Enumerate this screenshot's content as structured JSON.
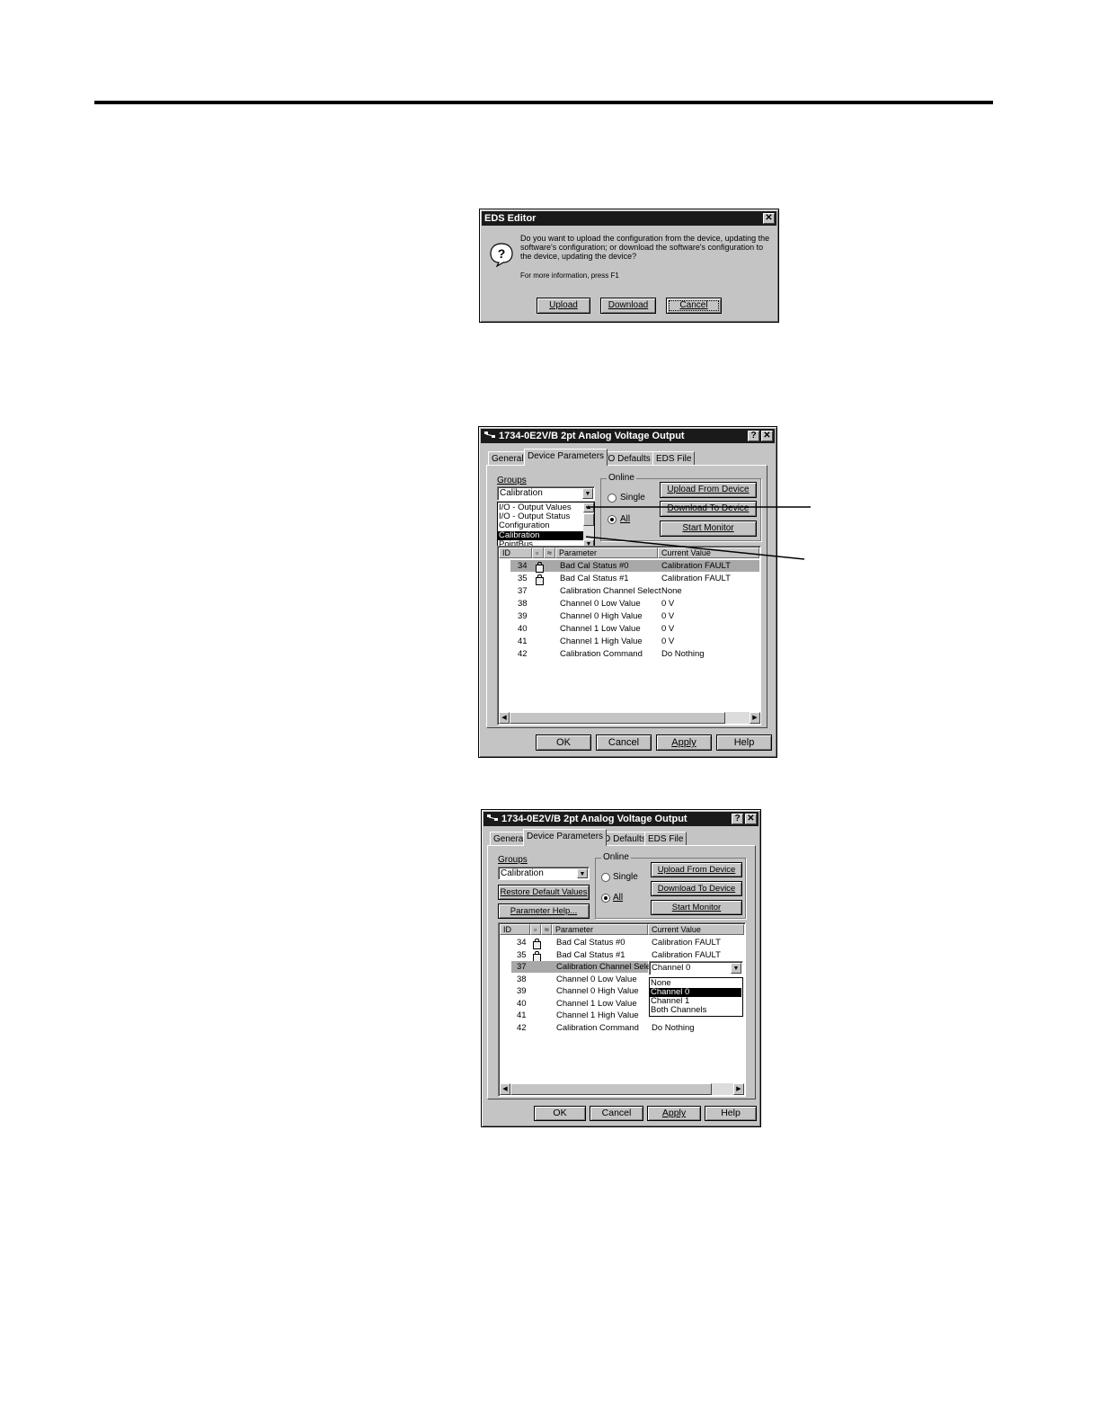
{
  "dialog_upload": {
    "title": "EDS Editor",
    "close": "✕",
    "message_lines": [
      "Do you want to upload the configuration from the device, updating the",
      "software's configuration; or download the software's configuration to",
      "the device, updating the device?"
    ],
    "help_text": "For more information, press F1",
    "icon": "question-icon",
    "buttons": {
      "upload": "Upload",
      "download": "Download",
      "cancel": "Cancel"
    }
  },
  "dialog_a": {
    "title": "1734-0E2V/B 2pt Analog Voltage Output",
    "help_btn": "?",
    "close_btn": "✕",
    "tabs": [
      "General",
      "Device Parameters",
      "I/O Defaults",
      "EDS File"
    ],
    "groups_label": "Groups",
    "groups_value": "Calibration",
    "groups_options": [
      "I/O - Output Values",
      "I/O - Output Status",
      "Configuration",
      "Calibration",
      "PointBus"
    ],
    "online_label": "Online",
    "radio_single": "Single",
    "radio_all": "All",
    "btn_upload": "Upload From Device",
    "btn_download": "Download To Device",
    "btn_monitor": "Start Monitor",
    "columns": [
      "ID",
      "Parameter",
      "Current Value"
    ],
    "rows": [
      {
        "id": "34",
        "param": "Bad Cal Status #0",
        "value": "Calibration FAULT"
      },
      {
        "id": "35",
        "param": "Bad Cal Status #1",
        "value": "Calibration FAULT"
      },
      {
        "id": "37",
        "param": "Calibration Channel Select",
        "value": "None"
      },
      {
        "id": "38",
        "param": "Channel 0 Low Value",
        "value": "0 V"
      },
      {
        "id": "39",
        "param": "Channel 0 High Value",
        "value": "0 V"
      },
      {
        "id": "40",
        "param": "Channel 1 Low Value",
        "value": "0 V"
      },
      {
        "id": "41",
        "param": "Channel 1 High Value",
        "value": "0 V"
      },
      {
        "id": "42",
        "param": "Calibration Command",
        "value": "Do Nothing"
      }
    ],
    "footer": {
      "ok": "OK",
      "cancel": "Cancel",
      "apply": "Apply",
      "help": "Help"
    }
  },
  "dialog_b": {
    "title": "1734-0E2V/B 2pt Analog Voltage Output",
    "help_btn": "?",
    "close_btn": "✕",
    "tabs": [
      "General",
      "Device Parameters",
      "I/O Defaults",
      "EDS File"
    ],
    "groups_label": "Groups",
    "groups_value": "Calibration",
    "btn_restore": "Restore Default Values",
    "btn_param_help": "Parameter Help...",
    "online_label": "Online",
    "radio_single": "Single",
    "radio_all": "All",
    "btn_upload": "Upload From Device",
    "btn_download": "Download To Device",
    "btn_monitor": "Start Monitor",
    "columns": [
      "ID",
      "Parameter",
      "Current Value"
    ],
    "rows": [
      {
        "id": "34",
        "param": "Bad Cal Status #0",
        "value": "Calibration FAULT"
      },
      {
        "id": "35",
        "param": "Bad Cal Status #1",
        "value": "Calibration FAULT"
      },
      {
        "id": "37",
        "param": "Calibration Channel Select",
        "value": ""
      },
      {
        "id": "38",
        "param": "Channel 0 Low Value",
        "value": ""
      },
      {
        "id": "39",
        "param": "Channel 0 High Value",
        "value": ""
      },
      {
        "id": "40",
        "param": "Channel 1 Low Value",
        "value": ""
      },
      {
        "id": "41",
        "param": "Channel 1 High Value",
        "value": ""
      },
      {
        "id": "42",
        "param": "Calibration Command",
        "value": "Do Nothing"
      }
    ],
    "select_value": "Channel 0",
    "select_options": [
      "None",
      "Channel 0",
      "Channel 1",
      "Both Channels"
    ],
    "footer": {
      "ok": "OK",
      "cancel": "Cancel",
      "apply": "Apply",
      "help": "Help"
    }
  }
}
